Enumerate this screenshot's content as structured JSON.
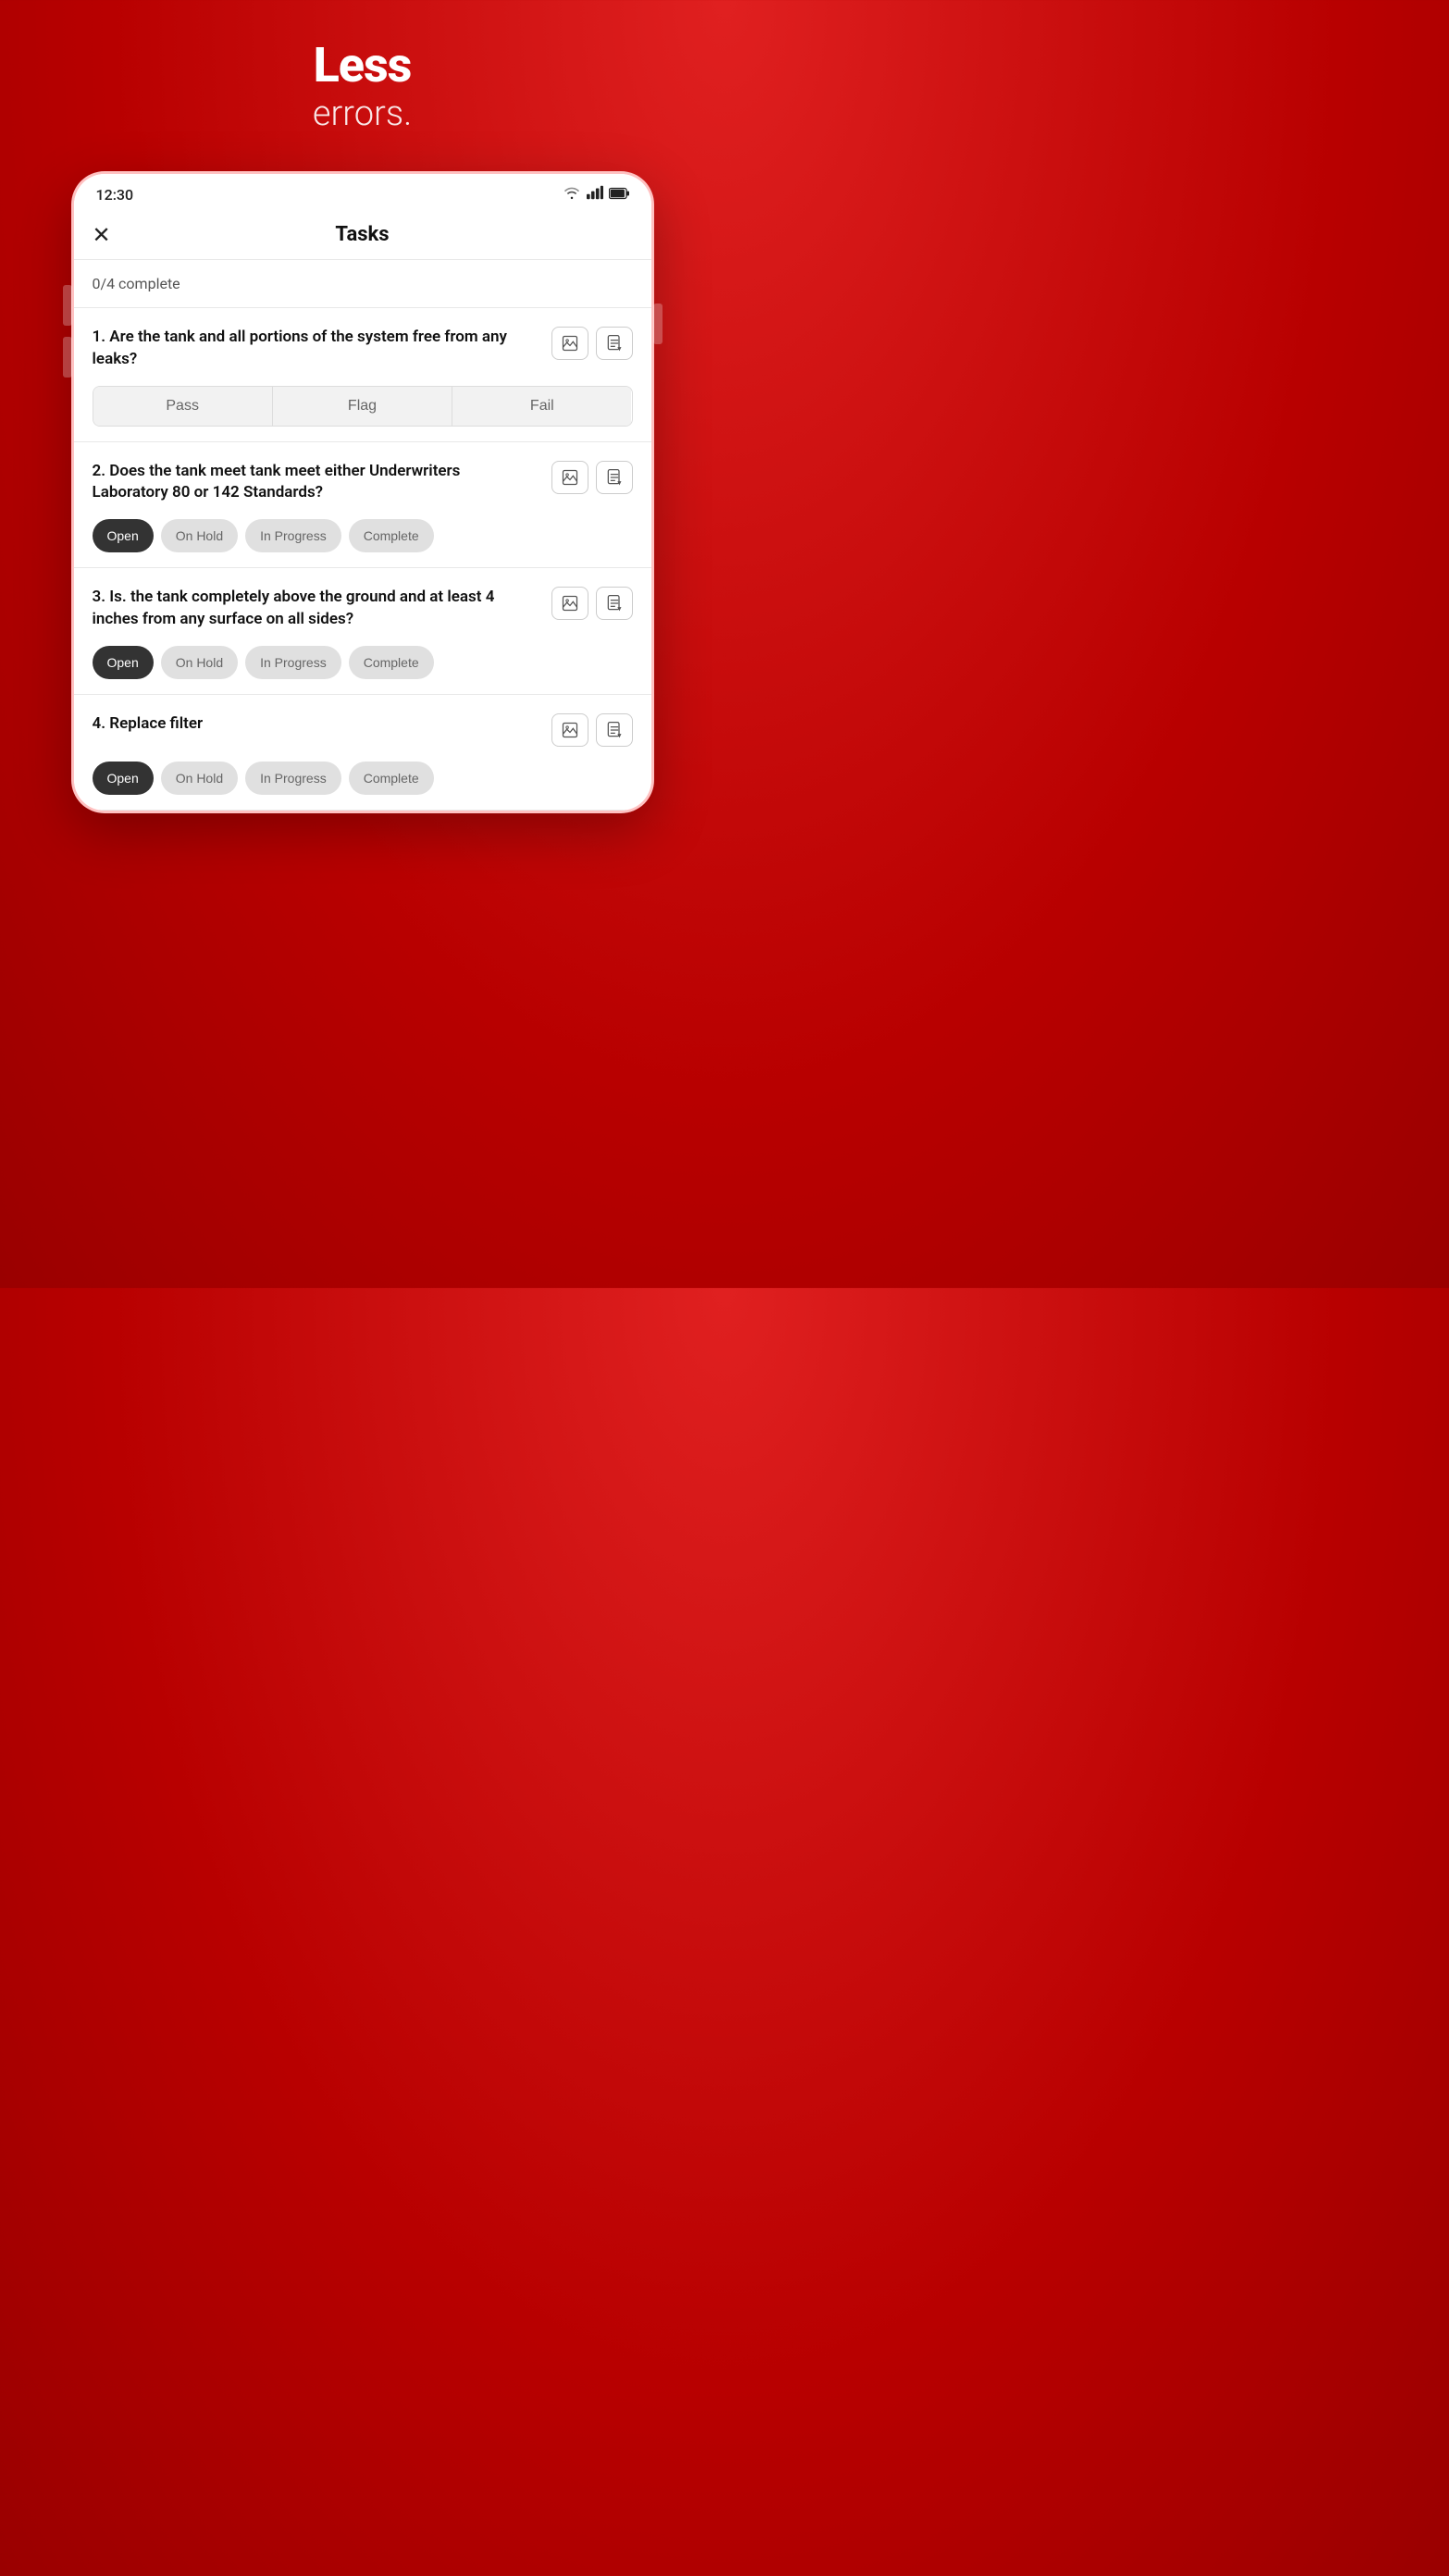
{
  "hero": {
    "less_label": "Less",
    "errors_label": "errors."
  },
  "status_bar": {
    "time": "12:30"
  },
  "header": {
    "close_label": "✕",
    "title": "Tasks"
  },
  "progress": {
    "text": "0/4 complete"
  },
  "tasks": [
    {
      "id": 1,
      "question": "1. Are the tank and all portions of the system free from any leaks?",
      "type": "pass_flag_fail",
      "buttons": [
        "Pass",
        "Flag",
        "Fail"
      ],
      "active_button": null
    },
    {
      "id": 2,
      "question": "2. Does the tank meet tank meet either Underwriters Laboratory 80 or 142 Standards?",
      "type": "status",
      "buttons": [
        "Open",
        "On Hold",
        "In Progress",
        "Complete"
      ],
      "active_button": "Open"
    },
    {
      "id": 3,
      "question": "3. Is. the tank completely above the ground and at least 4 inches from any surface on all sides?",
      "type": "status",
      "buttons": [
        "Open",
        "On Hold",
        "In Progress",
        "Complete"
      ],
      "active_button": "Open"
    },
    {
      "id": 4,
      "question": "4. Replace filter",
      "type": "status",
      "buttons": [
        "Open",
        "On Hold",
        "In Progress",
        "Complete"
      ],
      "active_button": "Open"
    }
  ]
}
